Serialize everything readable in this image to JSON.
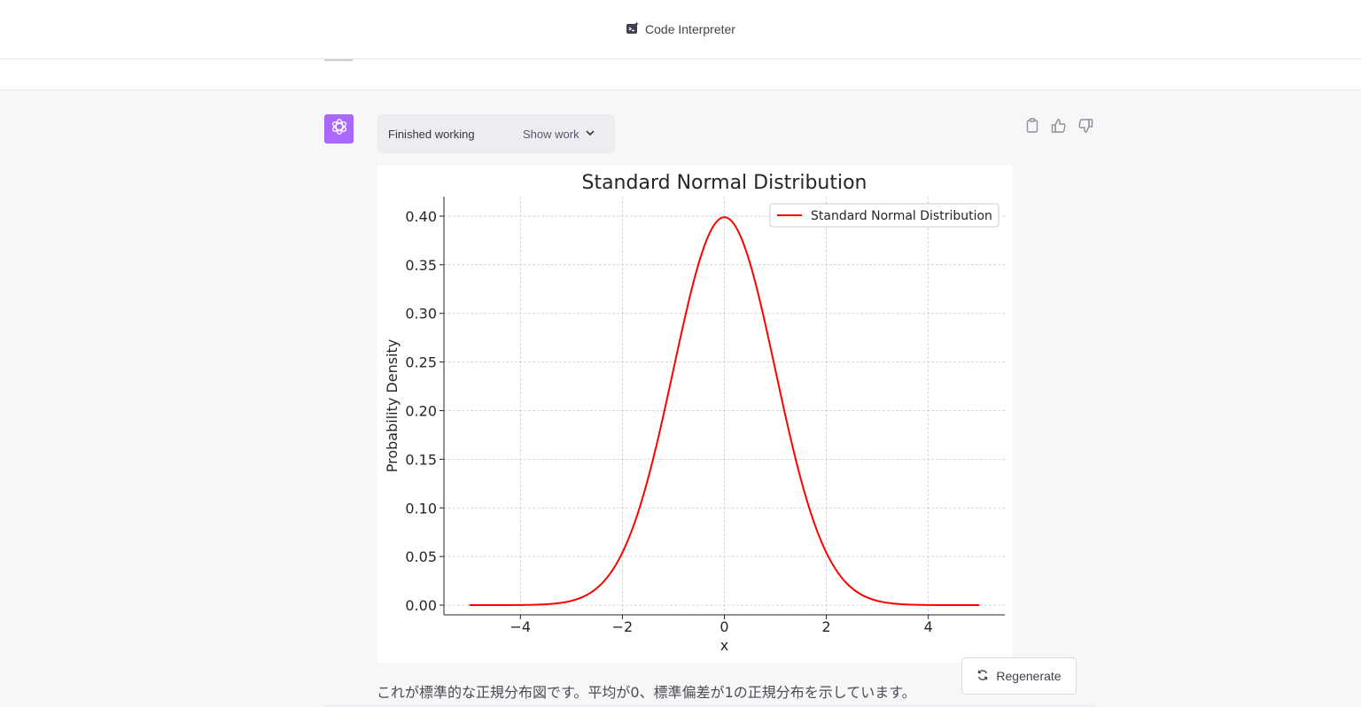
{
  "header": {
    "title": "Code Interpreter",
    "icon": "code-interpreter-icon"
  },
  "message": {
    "status_label": "Finished working",
    "show_work_label": "Show work",
    "answer_text": "これが標準的な正規分布図です。平均が0、標準偏差が1の正規分布を示しています。",
    "actions": [
      "copy-icon",
      "thumbs-up-icon",
      "thumbs-down-icon"
    ]
  },
  "regenerate": {
    "label": "Regenerate",
    "icon": "refresh-icon"
  },
  "colors": {
    "avatar_bg": "#ab68ff",
    "curve": "#ff0000",
    "page_bg": "#f7f7f8"
  },
  "chart_data": {
    "type": "line",
    "title": "Standard Normal Distribution",
    "xlabel": "x",
    "ylabel": "Probability Density",
    "xlim": [
      -5.5,
      5.5
    ],
    "ylim": [
      -0.01,
      0.42
    ],
    "xticks": [
      -4,
      -2,
      0,
      2,
      4
    ],
    "xtick_labels": [
      "−4",
      "−2",
      "0",
      "2",
      "4"
    ],
    "yticks": [
      0.0,
      0.05,
      0.1,
      0.15,
      0.2,
      0.25,
      0.3,
      0.35,
      0.4
    ],
    "ytick_labels": [
      "0.00",
      "0.05",
      "0.10",
      "0.15",
      "0.20",
      "0.25",
      "0.30",
      "0.35",
      "0.40"
    ],
    "grid": true,
    "legend_position": "top-right",
    "series": [
      {
        "name": "Standard Normal Distribution",
        "color": "#ff0000",
        "x": [
          -5.0,
          -4.5,
          -4.0,
          -3.5,
          -3.0,
          -2.5,
          -2.0,
          -1.5,
          -1.0,
          -0.5,
          0.0,
          0.5,
          1.0,
          1.5,
          2.0,
          2.5,
          3.0,
          3.5,
          4.0,
          4.5,
          5.0
        ],
        "y": [
          1.5e-06,
          1.6e-05,
          0.000134,
          0.000873,
          0.00443,
          0.01753,
          0.05399,
          0.12952,
          0.24197,
          0.35207,
          0.39894,
          0.35207,
          0.24197,
          0.12952,
          0.05399,
          0.01753,
          0.00443,
          0.000873,
          0.000134,
          1.6e-05,
          1.5e-06
        ]
      }
    ]
  }
}
